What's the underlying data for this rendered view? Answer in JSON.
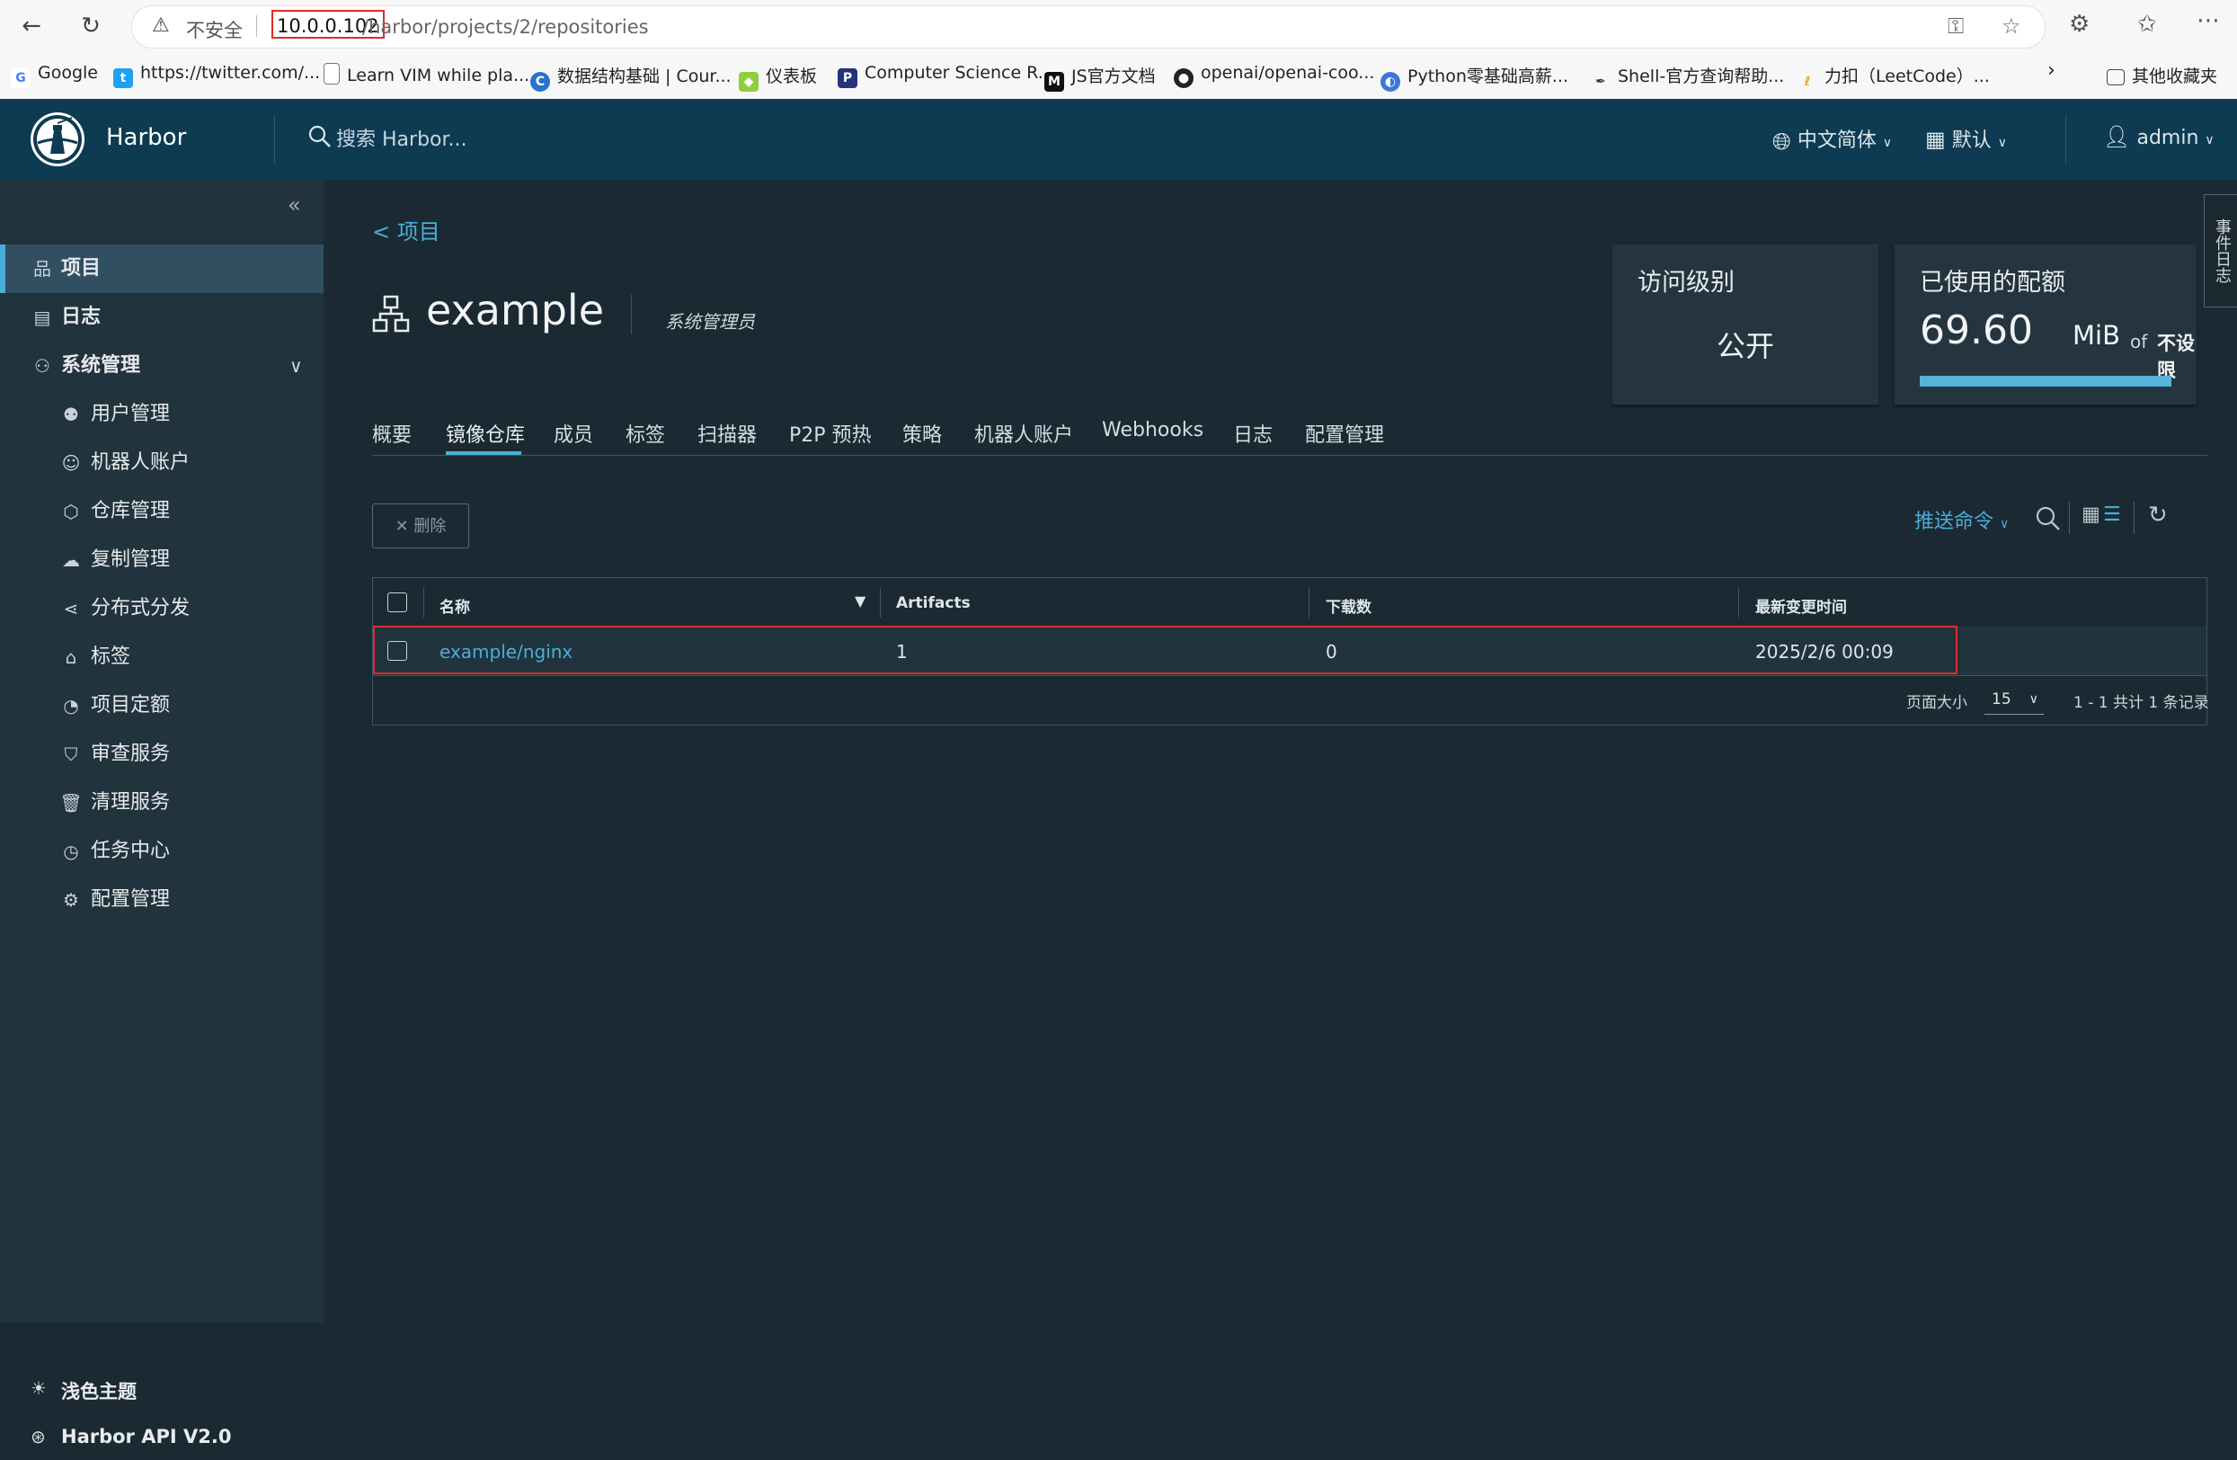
{
  "browser": {
    "insecure_label": "不安全",
    "url_host": "10.0.0.102",
    "url_path": "/harbor/projects/2/repositories",
    "bookmarks": [
      {
        "label": "Google",
        "icon": "google-icon"
      },
      {
        "label": "https://twitter.com/...",
        "icon": "twitter-icon"
      },
      {
        "label": "Learn VIM while pla...",
        "icon": "page-icon"
      },
      {
        "label": "数据结构基础 | Cour...",
        "icon": "coursera-icon"
      },
      {
        "label": "仪表板",
        "icon": "cube-icon"
      },
      {
        "label": "Computer Science R...",
        "icon": "p-icon"
      },
      {
        "label": "JS官方文档",
        "icon": "m-icon"
      },
      {
        "label": "openai/openai-coo...",
        "icon": "github-icon"
      },
      {
        "label": "Python零基础高薪...",
        "icon": "python-icon"
      },
      {
        "label": "Shell-官方查询帮助...",
        "icon": "shell-icon"
      },
      {
        "label": "力扣（LeetCode）...",
        "icon": "leetcode-icon"
      }
    ],
    "other_bookmarks": "其他收藏夹"
  },
  "header": {
    "brand": "Harbor",
    "search_placeholder": "搜索 Harbor...",
    "language": "中文简体",
    "date_format": "默认",
    "user": "admin"
  },
  "sidebar": {
    "items": [
      {
        "label": "项目",
        "icon": "project-icon"
      },
      {
        "label": "日志",
        "icon": "log-icon"
      },
      {
        "label": "系统管理",
        "icon": "admin-icon"
      }
    ],
    "sub_items": [
      {
        "label": "用户管理",
        "icon": "users-icon"
      },
      {
        "label": "机器人账户",
        "icon": "robot-icon"
      },
      {
        "label": "仓库管理",
        "icon": "registry-icon"
      },
      {
        "label": "复制管理",
        "icon": "replication-icon"
      },
      {
        "label": "分布式分发",
        "icon": "share-icon"
      },
      {
        "label": "标签",
        "icon": "tag-icon"
      },
      {
        "label": "项目定额",
        "icon": "quota-icon"
      },
      {
        "label": "审查服务",
        "icon": "shield-icon"
      },
      {
        "label": "清理服务",
        "icon": "trash-icon"
      },
      {
        "label": "任务中心",
        "icon": "dashboard-icon"
      },
      {
        "label": "配置管理",
        "icon": "gear-icon"
      }
    ],
    "theme_toggle": "浅色主题",
    "api_link": "Harbor API V2.0"
  },
  "main": {
    "back_link": "< 项目",
    "project_name": "example",
    "project_role": "系统管理员",
    "access_card": {
      "title": "访问级别",
      "value": "公开"
    },
    "quota_card": {
      "title": "已使用的配额",
      "used": "69.60",
      "unit": "MiB",
      "of": "of",
      "limit": "不设限",
      "fill_fraction": 1.0
    },
    "tabs": [
      "概要",
      "镜像仓库",
      "成员",
      "标签",
      "扫描器",
      "P2P 预热",
      "策略",
      "机器人账户",
      "Webhooks",
      "日志",
      "配置管理"
    ],
    "active_tab": "镜像仓库",
    "delete_button": "删除",
    "push_command": "推送命令",
    "table": {
      "columns": [
        "名称",
        "Artifacts",
        "下载数",
        "最新变更时间"
      ],
      "rows": [
        {
          "name": "example/nginx",
          "artifacts": "1",
          "downloads": "0",
          "updated": "2025/2/6 00:09"
        }
      ],
      "page_size_label": "页面大小",
      "page_size": "15",
      "summary": "1 - 1 共计 1 条记录"
    },
    "event_tab": "事件日志"
  }
}
